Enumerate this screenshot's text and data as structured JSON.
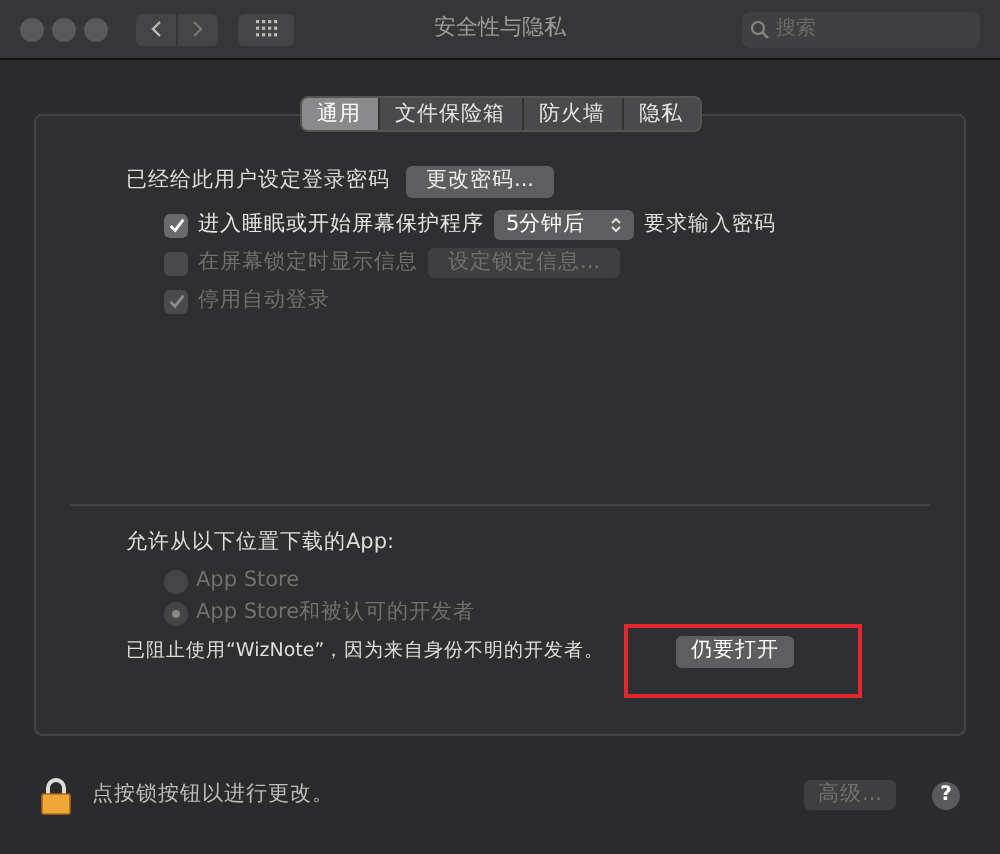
{
  "window": {
    "title": "安全性与隐私"
  },
  "search": {
    "placeholder": "搜索"
  },
  "tabs": [
    {
      "label": "通用",
      "selected": true
    },
    {
      "label": "文件保险箱",
      "selected": false
    },
    {
      "label": "防火墙",
      "selected": false
    },
    {
      "label": "隐私",
      "selected": false
    }
  ],
  "password": {
    "label": "已经给此用户设定登录密码",
    "button": "更改密码..."
  },
  "options": [
    {
      "kind": "select",
      "label": "进入睡眠或开始屏幕保护程序",
      "checked": true,
      "disabled": false,
      "value": "5分钟后",
      "suffix": "要求输入密码"
    },
    {
      "kind": "button",
      "label": "在屏幕锁定时显示信息",
      "checked": false,
      "disabled": true,
      "button": "设定锁定信息..."
    },
    {
      "kind": "plain",
      "label": "停用自动登录",
      "checked": true,
      "disabled": true
    }
  ],
  "downloads": {
    "heading": "允许从以下位置下载的App:",
    "sources": [
      {
        "label": "App Store",
        "selected": false,
        "disabled": true
      },
      {
        "label": "App Store和被认可的开发者",
        "selected": true,
        "disabled": true
      }
    ],
    "blocked_message": "已阻止使用“WizNote”，因为来自身份不明的开发者。",
    "open_button": "仍要打开",
    "highlighted": true
  },
  "footer": {
    "lock_text": "点按锁按钮以进行更改。",
    "advanced_button": "高级...",
    "advanced_disabled": true,
    "help": "?"
  }
}
